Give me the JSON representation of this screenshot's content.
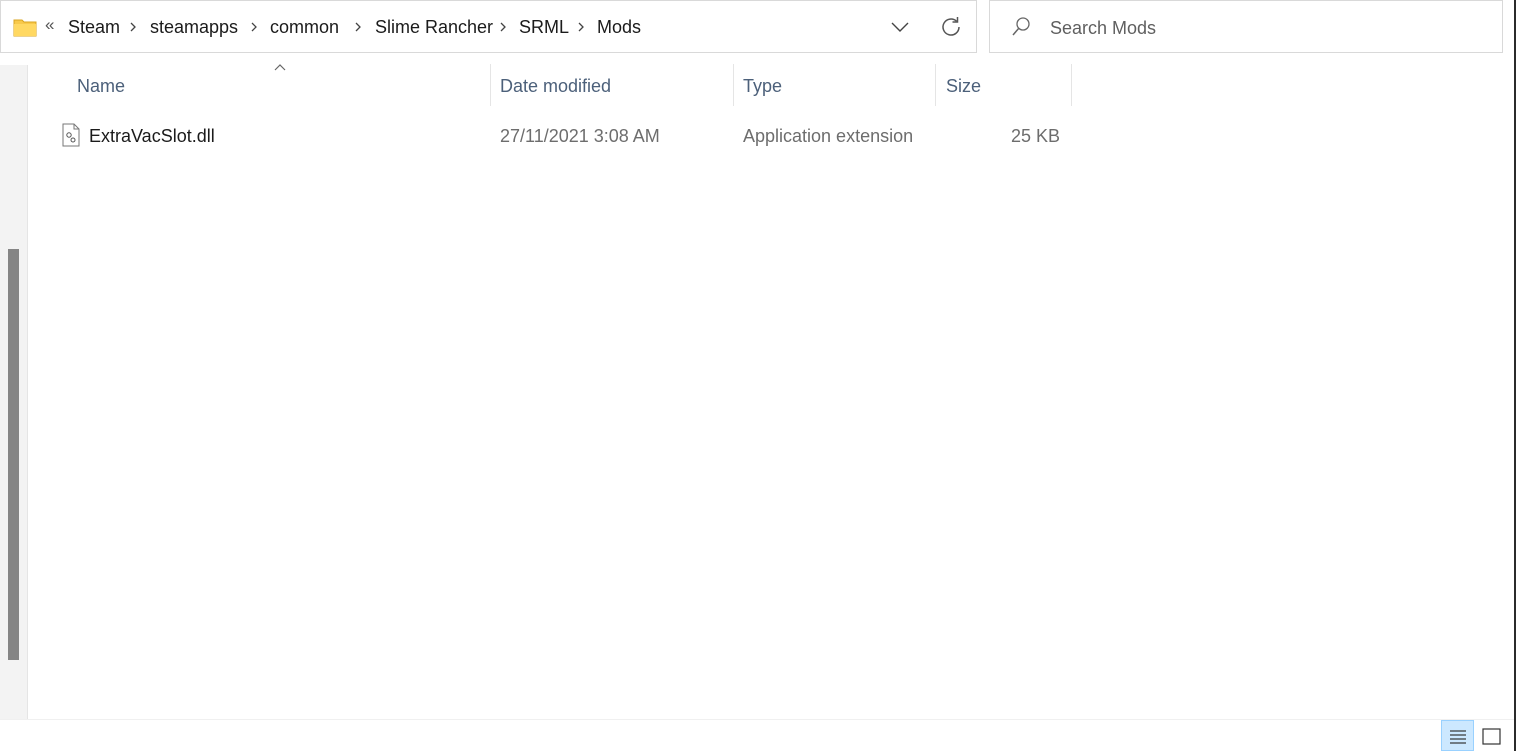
{
  "address_bar": {
    "overflow_glyph": "«",
    "breadcrumbs": [
      "Steam",
      "steamapps",
      "common",
      "Slime Rancher",
      "SRML",
      "Mods"
    ]
  },
  "search": {
    "placeholder": "Search Mods"
  },
  "columns": {
    "name": "Name",
    "date_modified": "Date modified",
    "type": "Type",
    "size": "Size",
    "sorted_by": "name"
  },
  "files": [
    {
      "name": "ExtraVacSlot.dll",
      "date_modified": "27/11/2021 3:08 AM",
      "type": "Application extension",
      "size": "25 KB",
      "icon": "dll-file-icon"
    }
  ],
  "view_mode": {
    "active": "details",
    "options": [
      "details-view-icon",
      "large-icons-view-icon"
    ]
  },
  "colors": {
    "header_text": "#4c607a",
    "secondary_text": "#6d6d6d",
    "folder_yellow": "#f8c94b",
    "selection_blue": "#cce8ff"
  }
}
